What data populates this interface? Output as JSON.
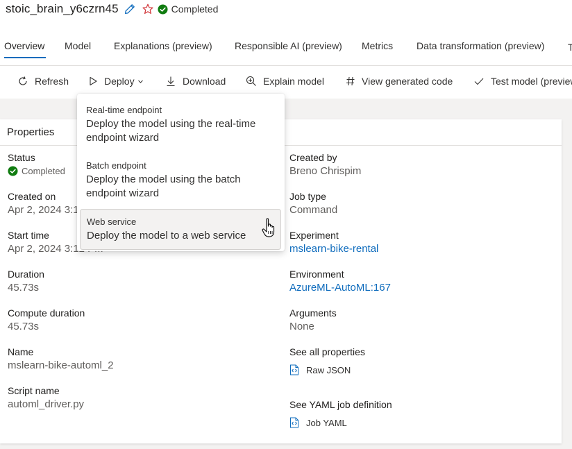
{
  "header": {
    "job_name": "stoic_brain_y6czrn45",
    "status": "Completed"
  },
  "tabs": [
    {
      "label": "Overview",
      "active": true
    },
    {
      "label": "Model"
    },
    {
      "label": "Explanations (preview)"
    },
    {
      "label": "Responsible AI (preview)"
    },
    {
      "label": "Metrics"
    },
    {
      "label": "Data transformation (preview)"
    }
  ],
  "toolbar": {
    "refresh": "Refresh",
    "deploy": "Deploy",
    "download": "Download",
    "explain_model": "Explain model",
    "view_code": "View generated code",
    "test_model": "Test model (preview)"
  },
  "properties": {
    "header": "Properties",
    "left": {
      "status_label": "Status",
      "status_value": "Completed",
      "created_on_label": "Created on",
      "created_on_value": "Apr 2, 2024 3:12 PM",
      "start_time_label": "Start time",
      "start_time_value": "Apr 2, 2024 3:12 PM",
      "duration_label": "Duration",
      "duration_value": "45.73s",
      "compute_duration_label": "Compute duration",
      "compute_duration_value": "45.73s",
      "name_label": "Name",
      "name_value": "mslearn-bike-automl_2",
      "script_name_label": "Script name",
      "script_name_value": "automl_driver.py"
    },
    "right": {
      "created_by_label": "Created by",
      "created_by_value": "Breno Chrispim",
      "job_type_label": "Job type",
      "job_type_value": "Command",
      "experiment_label": "Experiment",
      "experiment_value": "mslearn-bike-rental",
      "environment_label": "Environment",
      "environment_value": "AzureML-AutoML:167",
      "arguments_label": "Arguments",
      "arguments_value": "None",
      "all_props_label": "See all properties",
      "raw_json": "Raw JSON",
      "yaml_label": "See YAML job definition",
      "job_yaml": "Job YAML"
    }
  },
  "deploy_menu": [
    {
      "title": "Real-time endpoint",
      "description": "Deploy the model using the real-time endpoint wizard"
    },
    {
      "title": "Batch endpoint",
      "description": "Deploy the model using the batch endpoint wizard"
    },
    {
      "title": "Web service",
      "description": "Deploy the model to a web service"
    }
  ],
  "colors": {
    "accent": "#0f6cbd",
    "success": "#107c10",
    "star": "#d13438"
  }
}
